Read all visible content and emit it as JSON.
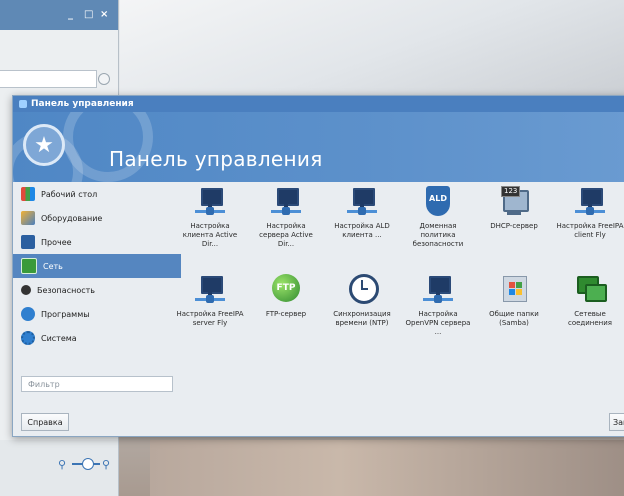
{
  "colors": {
    "title_bar": "#4a7fbf",
    "banner": "#5d91cb",
    "selection": "#5586c0"
  },
  "back_window": {
    "controls": [
      "_",
      "□",
      "×"
    ]
  },
  "window": {
    "title": "Панель управления",
    "banner_title": "Панель управления"
  },
  "sidebar": {
    "items": [
      {
        "label": "Рабочий стол",
        "icon": "desktop-icon"
      },
      {
        "label": "Оборудование",
        "icon": "hardware-icon"
      },
      {
        "label": "Прочее",
        "icon": "other-icon"
      },
      {
        "label": "Сеть",
        "icon": "network-icon",
        "selected": true
      },
      {
        "label": "Безопасность",
        "icon": "security-icon"
      },
      {
        "label": "Программы",
        "icon": "programs-icon"
      },
      {
        "label": "Система",
        "icon": "system-icon"
      }
    ],
    "filter_placeholder": "Фильтр"
  },
  "items": [
    {
      "label": "Настройка клиента Active Dir...",
      "icon": "network-monitor-icon"
    },
    {
      "label": "Настройка сервера Active Dir...",
      "icon": "network-monitor-icon"
    },
    {
      "label": "Настройка ALD клиента ...",
      "icon": "network-monitor-icon"
    },
    {
      "label": "Доменная политика безопасности",
      "icon": "ald-shield-icon"
    },
    {
      "label": "DHCP-сервер",
      "icon": "dhcp-icon"
    },
    {
      "label": "Настройка FreeIPA client Fly",
      "icon": "network-monitor-icon"
    },
    {
      "label": "Настройка FreeIPA server Fly",
      "icon": "network-monitor-icon"
    },
    {
      "label": "FTP-сервер",
      "icon": "ftp-icon"
    },
    {
      "label": "Синхронизация времени (NTP)",
      "icon": "clock-icon"
    },
    {
      "label": "Настройка OpenVPN сервера ...",
      "icon": "network-monitor-icon"
    },
    {
      "label": "Общие папки (Samba)",
      "icon": "samba-icon"
    },
    {
      "label": "Сетевые соединения",
      "icon": "network-connections-icon"
    }
  ],
  "buttons": {
    "help": "Справка",
    "close": "Закрыть"
  },
  "labels": {
    "ald": "ALD",
    "ftp": "FTP",
    "dhcp": "123"
  }
}
